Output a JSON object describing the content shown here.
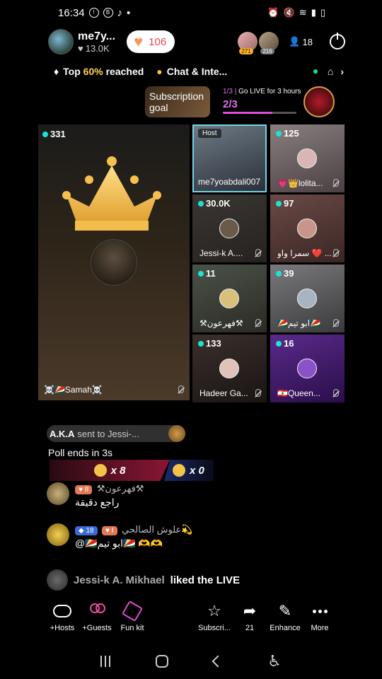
{
  "statusbar": {
    "time": "16:34"
  },
  "header": {
    "host_name": "me7y...",
    "host_likes": "13.0K",
    "like_count": "106",
    "viewer1_badge": "271",
    "viewer2_badge": "216",
    "viewer_count": "18"
  },
  "info": {
    "top_prefix": "Top ",
    "top_percent": "60%",
    "top_suffix": " reached",
    "chat_label": "Chat & Inte..."
  },
  "subscription": {
    "card_label": "Subscription goal",
    "go_live_fraction": "1/3",
    "go_live_text": "Go LIVE for 3 hours",
    "progress_text": "2/3",
    "progress": 0.67
  },
  "main_video": {
    "count": "331",
    "name": "☠️🇸🇨Samah☠️"
  },
  "tiles": [
    {
      "count": "",
      "host": "Host",
      "name": "me7yoabdali007"
    },
    {
      "count": "125",
      "name": "💗👑lolita..."
    },
    {
      "count": "30.0K",
      "name": "Jessi-k A...."
    },
    {
      "count": "97",
      "name": "سمرا واو ❤️ ..."
    },
    {
      "count": "11",
      "name": "⚒فهرعون⚒"
    },
    {
      "count": "39",
      "name": "🇸🇨ابو تيم🇸🇨"
    },
    {
      "count": "133",
      "name": "Hadeer Ga..."
    },
    {
      "count": "16",
      "name": "🇱🇧Queen..."
    }
  ],
  "gift_message": {
    "sender": "A.K.A",
    "text": "sent to Jessi-..."
  },
  "poll": {
    "title": "Poll ends in 3s",
    "left_count": "x 8",
    "right_count": "x 0"
  },
  "chat": [
    {
      "badge_heart": "II",
      "name": "⚒فهرعون⚒",
      "message": "راجع دقيقة"
    },
    {
      "badge_level": "18",
      "badge_heart": "I",
      "name": "علوش الصالحي💫",
      "message": "@🇸🇨ابو تيم🇸🇨 🫶🫶"
    }
  ],
  "liked": {
    "who": "Jessi-k A. Mikhael",
    "what": "liked the LIVE"
  },
  "toolbar": [
    {
      "label": "+Hosts"
    },
    {
      "label": "+Guests"
    },
    {
      "label": "Fun kit"
    },
    {
      "label": "Subscri..."
    },
    {
      "label": "21"
    },
    {
      "label": "Enhance"
    },
    {
      "label": "More"
    }
  ],
  "colors": {
    "accent_pink": "#e24ddc",
    "teal": "#1de3d3",
    "gold": "#ffd54d"
  }
}
